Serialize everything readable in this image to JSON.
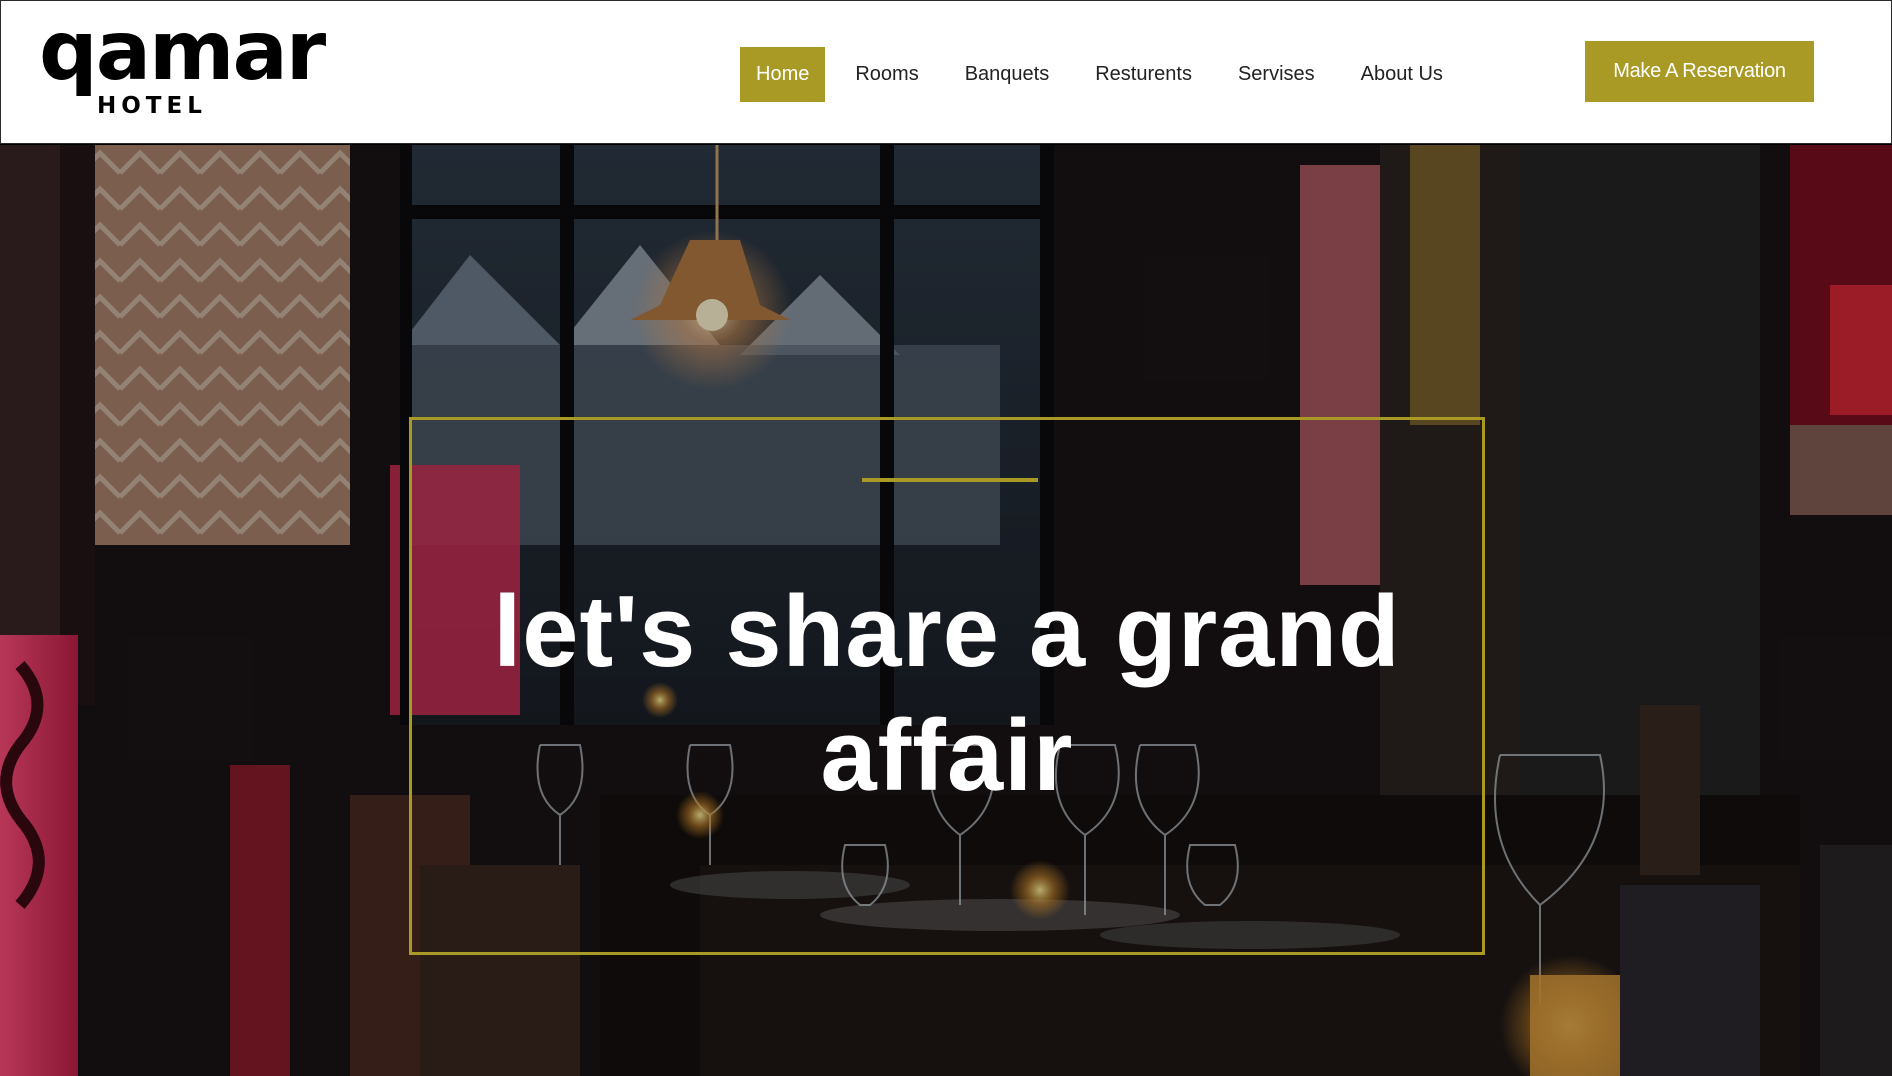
{
  "brand": {
    "name": "qamar",
    "subtitle": "HOTEL"
  },
  "nav": {
    "items": [
      {
        "label": "Home",
        "active": true
      },
      {
        "label": "Rooms",
        "active": false
      },
      {
        "label": "Banquets",
        "active": false
      },
      {
        "label": "Resturents",
        "active": false
      },
      {
        "label": "Servises",
        "active": false
      },
      {
        "label": "About Us",
        "active": false
      }
    ]
  },
  "cta": {
    "label": "Make A Reservation"
  },
  "hero": {
    "headline": "let's share a grand affair"
  },
  "colors": {
    "accent": "#a99a26",
    "header_bg": "#ffffff",
    "text_dark": "#222222",
    "hero_text": "#ffffff"
  },
  "icons": {
    "background": "restaurant-interior-photo"
  }
}
